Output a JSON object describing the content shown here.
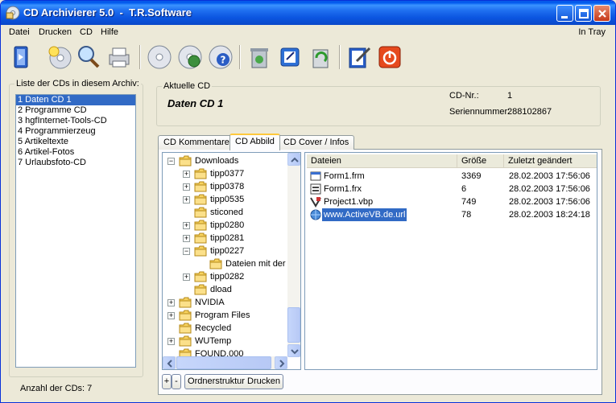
{
  "window": {
    "title": "CD Archivierer 5.0  -  T.R.Software"
  },
  "menu": {
    "items": [
      "Datei",
      "Drucken",
      "CD",
      "Hilfe"
    ],
    "in_tray": "In Tray"
  },
  "toolbar": {
    "icons": [
      "exit-icon",
      "new-cd-icon",
      "search-icon",
      "print-icon",
      "cd-icon",
      "cd-network-icon",
      "cd-help-icon",
      "recycle-bin-icon",
      "export-icon",
      "recycle-icon",
      "edit-check-icon",
      "power-icon"
    ]
  },
  "cd_list": {
    "legend": "Liste der CDs in diesem Archiv:",
    "items": [
      "1 Daten CD 1",
      "2 Programme CD",
      "3 hgfInternet-Tools-CD",
      "4 Programmierzeug",
      "5 Artikeltexte",
      "6 Artikel-Fotos",
      "7 Urlaubsfoto-CD"
    ],
    "selected_index": 0,
    "count_label": "Anzahl der CDs: 7"
  },
  "current_cd": {
    "legend": "Aktuelle CD",
    "name": "Daten CD 1",
    "cd_nr_label": "CD-Nr.:",
    "cd_nr_value": "1",
    "serial_label": "Seriennummer:",
    "serial_value": "288102867"
  },
  "tabs": [
    "CD Kommentare",
    "CD Abbild",
    "CD Cover / Infos"
  ],
  "active_tab": 1,
  "tree": {
    "rows": [
      {
        "label": "Downloads",
        "level": 0,
        "expander": "−"
      },
      {
        "label": "tipp0377",
        "level": 1,
        "expander": "+"
      },
      {
        "label": "tipp0378",
        "level": 1,
        "expander": "+"
      },
      {
        "label": "tipp0535",
        "level": 1,
        "expander": "+"
      },
      {
        "label": "sticoned",
        "level": 1,
        "expander": ""
      },
      {
        "label": "tipp0280",
        "level": 1,
        "expander": "+"
      },
      {
        "label": "tipp0281",
        "level": 1,
        "expander": "+"
      },
      {
        "label": "tipp0227",
        "level": 1,
        "expander": "−"
      },
      {
        "label": "Dateien mit der",
        "level": 2,
        "expander": ""
      },
      {
        "label": "tipp0282",
        "level": 1,
        "expander": "+"
      },
      {
        "label": "dload",
        "level": 1,
        "expander": ""
      },
      {
        "label": "NVIDIA",
        "level": 0,
        "expander": "+"
      },
      {
        "label": "Program Files",
        "level": 0,
        "expander": "+"
      },
      {
        "label": "Recycled",
        "level": 0,
        "expander": ""
      },
      {
        "label": "WUTemp",
        "level": 0,
        "expander": "+"
      },
      {
        "label": "FOUND.000",
        "level": 0,
        "expander": ""
      }
    ]
  },
  "files": {
    "columns": [
      "Dateien",
      "Größe",
      "Zuletzt geändert"
    ],
    "rows": [
      {
        "name": "Form1.frm",
        "size": "3369",
        "modified": "28.02.2003 17:56:06",
        "icon": "form-file-icon"
      },
      {
        "name": "Form1.frx",
        "size": "6",
        "modified": "28.02.2003 17:56:06",
        "icon": "binary-file-icon"
      },
      {
        "name": "Project1.vbp",
        "size": "749",
        "modified": "28.02.2003 17:56:06",
        "icon": "vb-project-icon"
      },
      {
        "name": "www.ActiveVB.de.url",
        "size": "78",
        "modified": "28.02.2003 18:24:18",
        "icon": "url-file-icon"
      }
    ],
    "selected_index": 3
  },
  "buttons": {
    "expand": "+",
    "collapse": "-",
    "print_structure": "Ordnerstruktur Drucken"
  }
}
